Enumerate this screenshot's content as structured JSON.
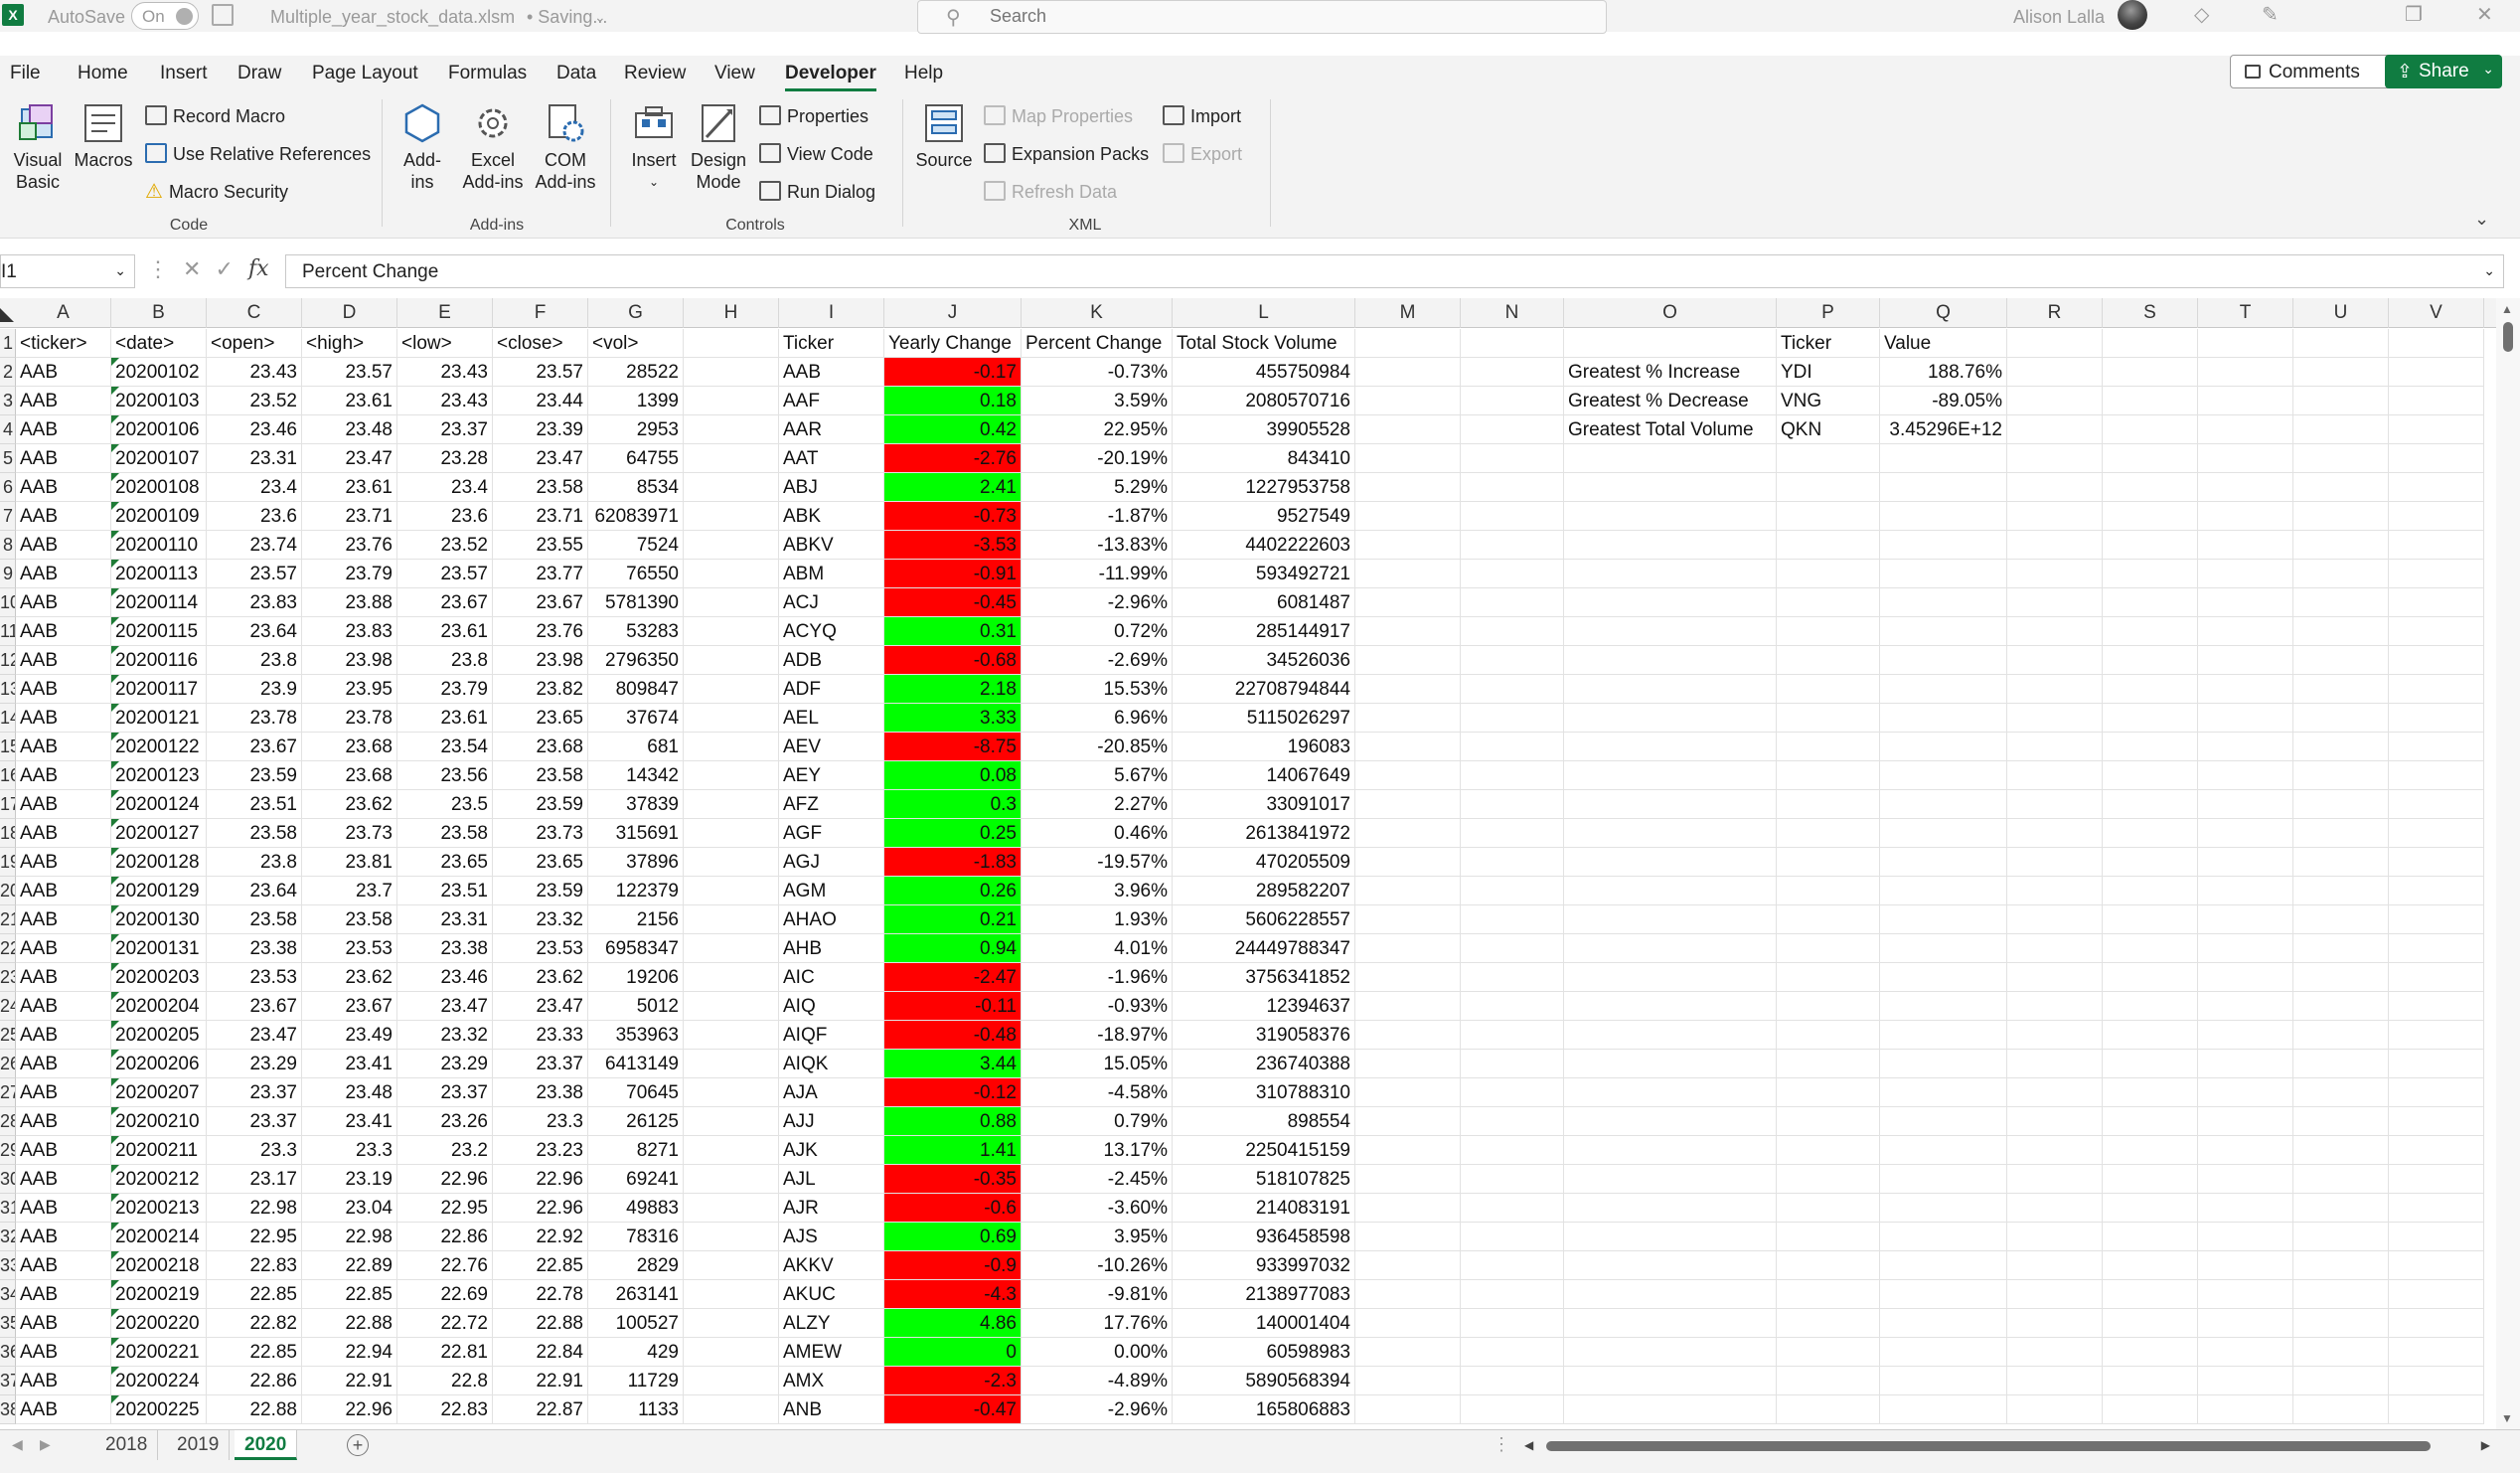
{
  "titlebar": {
    "app_icon": "excel-logo",
    "autosave_label": "AutoSave",
    "autosave_state": "On",
    "file_title": "Multiple_year_stock_data.xlsm",
    "save_status": "• Saving...",
    "search_placeholder": "Search",
    "user_name": "Alison Lalla",
    "icons": [
      "diamond-icon",
      "pen-icon",
      "restore-icon",
      "close-icon"
    ]
  },
  "menu": {
    "tabs": [
      "File",
      "Home",
      "Insert",
      "Draw",
      "Page Layout",
      "Formulas",
      "Data",
      "Review",
      "View",
      "Developer",
      "Help"
    ],
    "active": "Developer",
    "comments_label": "Comments",
    "share_label": "Share"
  },
  "ribbon": {
    "code": {
      "label": "Code",
      "visual_basic_1": "Visual",
      "visual_basic_2": "Basic",
      "macros": "Macros",
      "record_macro": "Record Macro",
      "use_relative_references": "Use Relative References",
      "macro_security": "Macro Security"
    },
    "addins": {
      "label": "Add-ins",
      "addins_1": "Add-",
      "addins_2": "ins",
      "excel_addins_1": "Excel",
      "excel_addins_2": "Add-ins",
      "com_addins_1": "COM",
      "com_addins_2": "Add-ins"
    },
    "controls": {
      "label": "Controls",
      "insert": "Insert",
      "design_mode_1": "Design",
      "design_mode_2": "Mode",
      "properties": "Properties",
      "view_code": "View Code",
      "run_dialog": "Run Dialog"
    },
    "xml": {
      "label": "XML",
      "source": "Source",
      "map_properties": "Map Properties",
      "expansion_packs": "Expansion Packs",
      "refresh_data": "Refresh Data",
      "import": "Import",
      "export": "Export"
    }
  },
  "formula_bar": {
    "name_box": "I1",
    "formula": "Percent Change"
  },
  "columns": [
    "A",
    "B",
    "C",
    "D",
    "E",
    "F",
    "G",
    "H",
    "I",
    "J",
    "K",
    "L",
    "M",
    "N",
    "O",
    "P",
    "Q",
    "R",
    "S",
    "T",
    "U",
    "V"
  ],
  "headers": {
    "data": [
      "<ticker>",
      "<date>",
      "<open>",
      "<high>",
      "<low>",
      "<close>",
      "<vol>"
    ],
    "summary": [
      "Ticker",
      "Yearly Change",
      "Percent Change",
      "Total Stock Volume"
    ],
    "greatest": [
      "Ticker",
      "Value"
    ]
  },
  "greatest": [
    [
      "Greatest % Increase",
      "YDI",
      "188.76%"
    ],
    [
      "Greatest % Decrease",
      "VNG",
      "-89.05%"
    ],
    [
      "Greatest Total Volume",
      "QKN",
      "3.45296E+12"
    ]
  ],
  "data_rows": [
    [
      "AAB",
      "20200102",
      "23.43",
      "23.57",
      "23.43",
      "23.57",
      "28522"
    ],
    [
      "AAB",
      "20200103",
      "23.52",
      "23.61",
      "23.43",
      "23.44",
      "1399"
    ],
    [
      "AAB",
      "20200106",
      "23.46",
      "23.48",
      "23.37",
      "23.39",
      "2953"
    ],
    [
      "AAB",
      "20200107",
      "23.31",
      "23.47",
      "23.28",
      "23.47",
      "64755"
    ],
    [
      "AAB",
      "20200108",
      "23.4",
      "23.61",
      "23.4",
      "23.58",
      "8534"
    ],
    [
      "AAB",
      "20200109",
      "23.6",
      "23.71",
      "23.6",
      "23.71",
      "62083971"
    ],
    [
      "AAB",
      "20200110",
      "23.74",
      "23.76",
      "23.52",
      "23.55",
      "7524"
    ],
    [
      "AAB",
      "20200113",
      "23.57",
      "23.79",
      "23.57",
      "23.77",
      "76550"
    ],
    [
      "AAB",
      "20200114",
      "23.83",
      "23.88",
      "23.67",
      "23.67",
      "5781390"
    ],
    [
      "AAB",
      "20200115",
      "23.64",
      "23.83",
      "23.61",
      "23.76",
      "53283"
    ],
    [
      "AAB",
      "20200116",
      "23.8",
      "23.98",
      "23.8",
      "23.98",
      "2796350"
    ],
    [
      "AAB",
      "20200117",
      "23.9",
      "23.95",
      "23.79",
      "23.82",
      "809847"
    ],
    [
      "AAB",
      "20200121",
      "23.78",
      "23.78",
      "23.61",
      "23.65",
      "37674"
    ],
    [
      "AAB",
      "20200122",
      "23.67",
      "23.68",
      "23.54",
      "23.68",
      "681"
    ],
    [
      "AAB",
      "20200123",
      "23.59",
      "23.68",
      "23.56",
      "23.58",
      "14342"
    ],
    [
      "AAB",
      "20200124",
      "23.51",
      "23.62",
      "23.5",
      "23.59",
      "37839"
    ],
    [
      "AAB",
      "20200127",
      "23.58",
      "23.73",
      "23.58",
      "23.73",
      "315691"
    ],
    [
      "AAB",
      "20200128",
      "23.8",
      "23.81",
      "23.65",
      "23.65",
      "37896"
    ],
    [
      "AAB",
      "20200129",
      "23.64",
      "23.7",
      "23.51",
      "23.59",
      "122379"
    ],
    [
      "AAB",
      "20200130",
      "23.58",
      "23.58",
      "23.31",
      "23.32",
      "2156"
    ],
    [
      "AAB",
      "20200131",
      "23.38",
      "23.53",
      "23.38",
      "23.53",
      "6958347"
    ],
    [
      "AAB",
      "20200203",
      "23.53",
      "23.62",
      "23.46",
      "23.62",
      "19206"
    ],
    [
      "AAB",
      "20200204",
      "23.67",
      "23.67",
      "23.47",
      "23.47",
      "5012"
    ],
    [
      "AAB",
      "20200205",
      "23.47",
      "23.49",
      "23.32",
      "23.33",
      "353963"
    ],
    [
      "AAB",
      "20200206",
      "23.29",
      "23.41",
      "23.29",
      "23.37",
      "6413149"
    ],
    [
      "AAB",
      "20200207",
      "23.37",
      "23.48",
      "23.37",
      "23.38",
      "70645"
    ],
    [
      "AAB",
      "20200210",
      "23.37",
      "23.41",
      "23.26",
      "23.3",
      "26125"
    ],
    [
      "AAB",
      "20200211",
      "23.3",
      "23.3",
      "23.2",
      "23.23",
      "8271"
    ],
    [
      "AAB",
      "20200212",
      "23.17",
      "23.19",
      "22.96",
      "22.96",
      "69241"
    ],
    [
      "AAB",
      "20200213",
      "22.98",
      "23.04",
      "22.95",
      "22.96",
      "49883"
    ],
    [
      "AAB",
      "20200214",
      "22.95",
      "22.98",
      "22.86",
      "22.92",
      "78316"
    ],
    [
      "AAB",
      "20200218",
      "22.83",
      "22.89",
      "22.76",
      "22.85",
      "2829"
    ],
    [
      "AAB",
      "20200219",
      "22.85",
      "22.85",
      "22.69",
      "22.78",
      "263141"
    ],
    [
      "AAB",
      "20200220",
      "22.82",
      "22.88",
      "22.72",
      "22.88",
      "100527"
    ],
    [
      "AAB",
      "20200221",
      "22.85",
      "22.94",
      "22.81",
      "22.84",
      "429"
    ],
    [
      "AAB",
      "20200224",
      "22.86",
      "22.91",
      "22.8",
      "22.91",
      "11729"
    ],
    [
      "AAB",
      "20200225",
      "22.88",
      "22.96",
      "22.83",
      "22.87",
      "1133"
    ]
  ],
  "summary_rows": [
    [
      "AAB",
      "-0.17",
      "-0.73%",
      "455750984"
    ],
    [
      "AAF",
      "0.18",
      "3.59%",
      "2080570716"
    ],
    [
      "AAR",
      "0.42",
      "22.95%",
      "39905528"
    ],
    [
      "AAT",
      "-2.76",
      "-20.19%",
      "843410"
    ],
    [
      "ABJ",
      "2.41",
      "5.29%",
      "1227953758"
    ],
    [
      "ABK",
      "-0.73",
      "-1.87%",
      "9527549"
    ],
    [
      "ABKV",
      "-3.53",
      "-13.83%",
      "4402222603"
    ],
    [
      "ABM",
      "-0.91",
      "-11.99%",
      "593492721"
    ],
    [
      "ACJ",
      "-0.45",
      "-2.96%",
      "6081487"
    ],
    [
      "ACYQ",
      "0.31",
      "0.72%",
      "285144917"
    ],
    [
      "ADB",
      "-0.68",
      "-2.69%",
      "34526036"
    ],
    [
      "ADF",
      "2.18",
      "15.53%",
      "22708794844"
    ],
    [
      "AEL",
      "3.33",
      "6.96%",
      "5115026297"
    ],
    [
      "AEV",
      "-8.75",
      "-20.85%",
      "196083"
    ],
    [
      "AEY",
      "0.08",
      "5.67%",
      "14067649"
    ],
    [
      "AFZ",
      "0.3",
      "2.27%",
      "33091017"
    ],
    [
      "AGF",
      "0.25",
      "0.46%",
      "2613841972"
    ],
    [
      "AGJ",
      "-1.83",
      "-19.57%",
      "470205509"
    ],
    [
      "AGM",
      "0.26",
      "3.96%",
      "289582207"
    ],
    [
      "AHAO",
      "0.21",
      "1.93%",
      "5606228557"
    ],
    [
      "AHB",
      "0.94",
      "4.01%",
      "24449788347"
    ],
    [
      "AIC",
      "-2.47",
      "-1.96%",
      "3756341852"
    ],
    [
      "AIQ",
      "-0.11",
      "-0.93%",
      "12394637"
    ],
    [
      "AIQF",
      "-0.48",
      "-18.97%",
      "319058376"
    ],
    [
      "AIQK",
      "3.44",
      "15.05%",
      "236740388"
    ],
    [
      "AJA",
      "-0.12",
      "-4.58%",
      "310788310"
    ],
    [
      "AJJ",
      "0.88",
      "0.79%",
      "898554"
    ],
    [
      "AJK",
      "1.41",
      "13.17%",
      "2250415159"
    ],
    [
      "AJL",
      "-0.35",
      "-2.45%",
      "518107825"
    ],
    [
      "AJR",
      "-0.6",
      "-3.60%",
      "214083191"
    ],
    [
      "AJS",
      "0.69",
      "3.95%",
      "936458598"
    ],
    [
      "AKKV",
      "-0.9",
      "-10.26%",
      "933997032"
    ],
    [
      "AKUC",
      "-4.3",
      "-9.81%",
      "2138977083"
    ],
    [
      "ALZY",
      "4.86",
      "17.76%",
      "140001404"
    ],
    [
      "AMEW",
      "0",
      "0.00%",
      "60598983"
    ],
    [
      "AMX",
      "-2.3",
      "-4.89%",
      "5890568394"
    ],
    [
      "ANB",
      "-0.47",
      "-2.96%",
      "165806883"
    ]
  ],
  "row_numbers": [
    "1",
    "2",
    "3",
    "4",
    "5",
    "6",
    "7",
    "8",
    "9",
    "10",
    "11",
    "12",
    "13",
    "14",
    "15",
    "16",
    "17",
    "18",
    "19",
    "20",
    "21",
    "22",
    "23",
    "24",
    "25",
    "26",
    "27",
    "28",
    "29",
    "30",
    "31",
    "32",
    "33",
    "34",
    "35",
    "36",
    "37",
    "38"
  ],
  "sheets": [
    "2018",
    "2019",
    "2020"
  ],
  "active_sheet": "2020",
  "colors": {
    "positive_fill": "#00ff00",
    "negative_fill": "#ff0000",
    "accent": "#107c41"
  }
}
